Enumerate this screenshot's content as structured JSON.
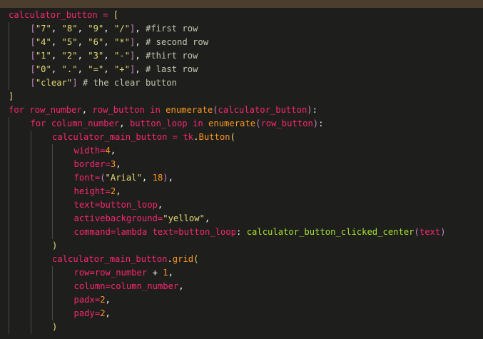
{
  "editor": {
    "language": "python",
    "theme": "dark"
  },
  "code_lines": [
    {
      "indent": 0,
      "tokens": [
        {
          "t": "calculator_button",
          "c": "var"
        },
        {
          "t": " = ",
          "c": "op"
        },
        {
          "t": "[",
          "c": "bracket"
        }
      ]
    },
    {
      "indent": 1,
      "tokens": [
        {
          "t": "[",
          "c": "paren"
        },
        {
          "t": "\"7\"",
          "c": "string"
        },
        {
          "t": ", ",
          "c": "punct"
        },
        {
          "t": "\"8\"",
          "c": "string"
        },
        {
          "t": ", ",
          "c": "punct"
        },
        {
          "t": "\"9\"",
          "c": "string"
        },
        {
          "t": ", ",
          "c": "punct"
        },
        {
          "t": "\"/\"",
          "c": "string"
        },
        {
          "t": "]",
          "c": "paren"
        },
        {
          "t": ", ",
          "c": "punct"
        },
        {
          "t": "#first row",
          "c": "comment"
        }
      ]
    },
    {
      "indent": 1,
      "tokens": [
        {
          "t": "[",
          "c": "paren"
        },
        {
          "t": "\"4\"",
          "c": "string"
        },
        {
          "t": ", ",
          "c": "punct"
        },
        {
          "t": "\"5\"",
          "c": "string"
        },
        {
          "t": ", ",
          "c": "punct"
        },
        {
          "t": "\"6\"",
          "c": "string"
        },
        {
          "t": ", ",
          "c": "punct"
        },
        {
          "t": "\"*\"",
          "c": "string"
        },
        {
          "t": "]",
          "c": "paren"
        },
        {
          "t": ", ",
          "c": "punct"
        },
        {
          "t": "# second row",
          "c": "comment"
        }
      ]
    },
    {
      "indent": 1,
      "tokens": [
        {
          "t": "[",
          "c": "paren"
        },
        {
          "t": "\"1\"",
          "c": "string"
        },
        {
          "t": ", ",
          "c": "punct"
        },
        {
          "t": "\"2\"",
          "c": "string"
        },
        {
          "t": ", ",
          "c": "punct"
        },
        {
          "t": "\"3\"",
          "c": "string"
        },
        {
          "t": ", ",
          "c": "punct"
        },
        {
          "t": "\"-\"",
          "c": "string"
        },
        {
          "t": "]",
          "c": "paren"
        },
        {
          "t": ", ",
          "c": "punct"
        },
        {
          "t": "#thirt row",
          "c": "comment"
        }
      ]
    },
    {
      "indent": 1,
      "tokens": [
        {
          "t": "[",
          "c": "paren"
        },
        {
          "t": "\"0\"",
          "c": "string"
        },
        {
          "t": ", ",
          "c": "punct"
        },
        {
          "t": "\".\"",
          "c": "string"
        },
        {
          "t": ", ",
          "c": "punct"
        },
        {
          "t": "\"=\"",
          "c": "string"
        },
        {
          "t": ", ",
          "c": "punct"
        },
        {
          "t": "\"+\"",
          "c": "string"
        },
        {
          "t": "]",
          "c": "paren"
        },
        {
          "t": ", ",
          "c": "punct"
        },
        {
          "t": "# last row",
          "c": "comment"
        }
      ]
    },
    {
      "indent": 1,
      "tokens": [
        {
          "t": "[",
          "c": "paren"
        },
        {
          "t": "\"clear\"",
          "c": "string"
        },
        {
          "t": "]",
          "c": "paren"
        },
        {
          "t": " ",
          "c": "punct"
        },
        {
          "t": "# the clear button",
          "c": "comment"
        }
      ]
    },
    {
      "indent": 0,
      "tokens": [
        {
          "t": "]",
          "c": "bracket"
        }
      ]
    },
    {
      "indent": 0,
      "tokens": [
        {
          "t": "for",
          "c": "keyword"
        },
        {
          "t": " ",
          "c": "plain"
        },
        {
          "t": "row_number",
          "c": "var"
        },
        {
          "t": ", ",
          "c": "punct"
        },
        {
          "t": "row_button",
          "c": "var"
        },
        {
          "t": " in ",
          "c": "keyword"
        },
        {
          "t": "enumerate",
          "c": "func"
        },
        {
          "t": "(",
          "c": "paren"
        },
        {
          "t": "calculator_button",
          "c": "var"
        },
        {
          "t": ")",
          "c": "paren"
        },
        {
          "t": ":",
          "c": "punct"
        }
      ]
    },
    {
      "indent": 1,
      "tokens": [
        {
          "t": "for",
          "c": "keyword"
        },
        {
          "t": " ",
          "c": "plain"
        },
        {
          "t": "column_number",
          "c": "var"
        },
        {
          "t": ", ",
          "c": "punct"
        },
        {
          "t": "button_loop",
          "c": "var"
        },
        {
          "t": " in ",
          "c": "keyword"
        },
        {
          "t": "enumerate",
          "c": "func"
        },
        {
          "t": "(",
          "c": "paren"
        },
        {
          "t": "row_button",
          "c": "var"
        },
        {
          "t": ")",
          "c": "paren"
        },
        {
          "t": ":",
          "c": "punct"
        }
      ]
    },
    {
      "indent": 2,
      "tokens": [
        {
          "t": "calculator_main_button",
          "c": "var"
        },
        {
          "t": " = ",
          "c": "op"
        },
        {
          "t": "tk",
          "c": "var"
        },
        {
          "t": ".",
          "c": "punct"
        },
        {
          "t": "Button",
          "c": "func"
        },
        {
          "t": "(",
          "c": "bracket"
        }
      ]
    },
    {
      "indent": 3,
      "tokens": [
        {
          "t": "width",
          "c": "param"
        },
        {
          "t": "=",
          "c": "op"
        },
        {
          "t": "4",
          "c": "number"
        },
        {
          "t": ",",
          "c": "punct"
        }
      ]
    },
    {
      "indent": 3,
      "tokens": [
        {
          "t": "border",
          "c": "param"
        },
        {
          "t": "=",
          "c": "op"
        },
        {
          "t": "3",
          "c": "number"
        },
        {
          "t": ",",
          "c": "punct"
        }
      ]
    },
    {
      "indent": 3,
      "tokens": [
        {
          "t": "font",
          "c": "param"
        },
        {
          "t": "=",
          "c": "op"
        },
        {
          "t": "(",
          "c": "paren"
        },
        {
          "t": "\"Arial\"",
          "c": "string"
        },
        {
          "t": ", ",
          "c": "punct"
        },
        {
          "t": "18",
          "c": "number"
        },
        {
          "t": ")",
          "c": "paren"
        },
        {
          "t": ",",
          "c": "punct"
        }
      ]
    },
    {
      "indent": 3,
      "tokens": [
        {
          "t": "height",
          "c": "param"
        },
        {
          "t": "=",
          "c": "op"
        },
        {
          "t": "2",
          "c": "number"
        },
        {
          "t": ",",
          "c": "punct"
        }
      ]
    },
    {
      "indent": 3,
      "tokens": [
        {
          "t": "text",
          "c": "param"
        },
        {
          "t": "=",
          "c": "op"
        },
        {
          "t": "button_loop",
          "c": "var"
        },
        {
          "t": ",",
          "c": "punct"
        }
      ]
    },
    {
      "indent": 3,
      "tokens": [
        {
          "t": "activebackground",
          "c": "param"
        },
        {
          "t": "=",
          "c": "op"
        },
        {
          "t": "\"yellow\"",
          "c": "string"
        },
        {
          "t": ",",
          "c": "punct"
        }
      ]
    },
    {
      "indent": 3,
      "tokens": [
        {
          "t": "command",
          "c": "param"
        },
        {
          "t": "=",
          "c": "op"
        },
        {
          "t": "lambda",
          "c": "keyword"
        },
        {
          "t": " ",
          "c": "plain"
        },
        {
          "t": "text",
          "c": "param"
        },
        {
          "t": "=",
          "c": "op"
        },
        {
          "t": "button_loop",
          "c": "var"
        },
        {
          "t": ": ",
          "c": "punct"
        },
        {
          "t": "calculator_button_clicked_center",
          "c": "call"
        },
        {
          "t": "(",
          "c": "paren"
        },
        {
          "t": "text",
          "c": "var"
        },
        {
          "t": ")",
          "c": "paren"
        }
      ]
    },
    {
      "indent": 2,
      "tokens": [
        {
          "t": ")",
          "c": "bracket"
        }
      ]
    },
    {
      "indent": 2,
      "tokens": [
        {
          "t": "calculator_main_button",
          "c": "var"
        },
        {
          "t": ".",
          "c": "punct"
        },
        {
          "t": "grid",
          "c": "func"
        },
        {
          "t": "(",
          "c": "bracket"
        }
      ]
    },
    {
      "indent": 3,
      "tokens": [
        {
          "t": "row",
          "c": "param"
        },
        {
          "t": "=",
          "c": "op"
        },
        {
          "t": "row_number",
          "c": "var"
        },
        {
          "t": " + ",
          "c": "punct"
        },
        {
          "t": "1",
          "c": "number"
        },
        {
          "t": ",",
          "c": "punct"
        }
      ]
    },
    {
      "indent": 3,
      "tokens": [
        {
          "t": "column",
          "c": "param"
        },
        {
          "t": "=",
          "c": "op"
        },
        {
          "t": "column_number",
          "c": "var"
        },
        {
          "t": ",",
          "c": "punct"
        }
      ]
    },
    {
      "indent": 3,
      "tokens": [
        {
          "t": "padx",
          "c": "param"
        },
        {
          "t": "=",
          "c": "op"
        },
        {
          "t": "2",
          "c": "number"
        },
        {
          "t": ",",
          "c": "punct"
        }
      ]
    },
    {
      "indent": 3,
      "tokens": [
        {
          "t": "pady",
          "c": "param"
        },
        {
          "t": "=",
          "c": "op"
        },
        {
          "t": "2",
          "c": "number"
        },
        {
          "t": ",",
          "c": "punct"
        }
      ]
    },
    {
      "indent": 2,
      "tokens": [
        {
          "t": ")",
          "c": "bracket"
        }
      ]
    }
  ]
}
